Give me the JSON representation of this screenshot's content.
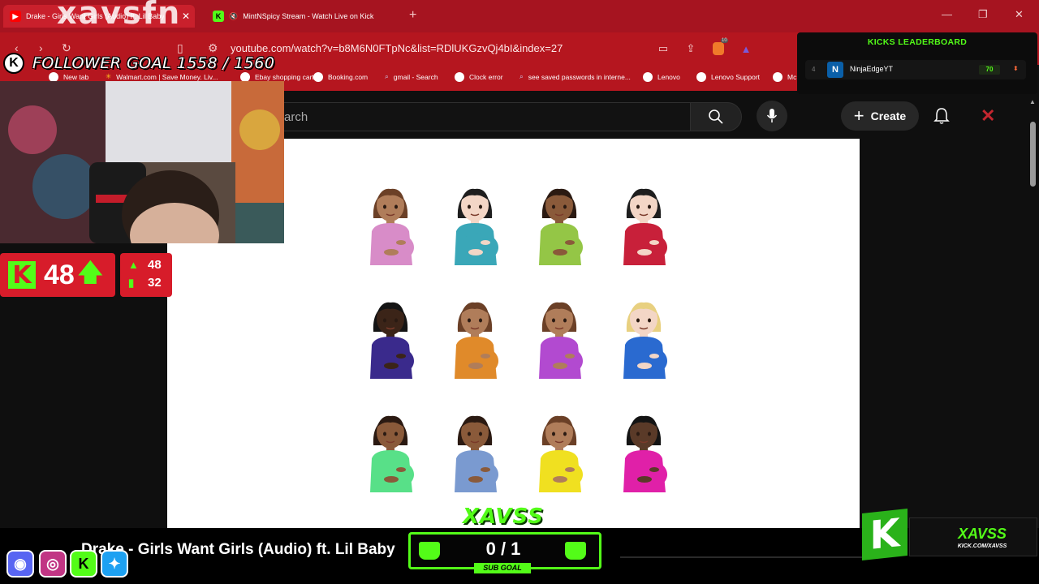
{
  "browser": {
    "tabs": [
      {
        "label": "Drake - Girls Want Girls (Audio) ft. Lil Baby",
        "active": true
      },
      {
        "label": "MintNSpicy Stream - Watch Live on Kick",
        "active": false
      }
    ],
    "url": "youtube.com/watch?v=b8M6N0FTpNc&list=RDlUKGzvQj4bI&index=27",
    "bookmarks": [
      "New tab",
      "Walmart.com | Save Money. Liv...",
      "Ebay shopping cart",
      "Booking.com",
      "gmail - Search",
      "Clock error",
      "see saved passwords in interne...",
      "Lenovo",
      "Lenovo Support",
      "Mc"
    ],
    "extension_badge": "10"
  },
  "youtube": {
    "search_placeholder": "arch",
    "create_label": "Create"
  },
  "overlay": {
    "channel_logo": "xavsfn",
    "follower_goal": "FOLLOWER GOAL 1558 / 1560",
    "kick_letter": "K",
    "follower_count": "48",
    "stat_up": "48",
    "stat_bars": "32",
    "leaderboard_title": "KICKS LEADERBOARD",
    "leaderboard": [
      {
        "rank": "4",
        "name": "NinjaEdgeYT",
        "value": "70"
      }
    ],
    "now_playing": "Drake - Girls Want Girls (Audio) ft. Lil Baby",
    "sub_goal_value": "0 / 1",
    "sub_goal_label": "SUB GOAL",
    "streamer_name": "XAVSS",
    "streamer_url": "KICK.COM/XAVSS",
    "sub_goal_banner": "XAVSS"
  },
  "emojis": [
    {
      "skin": "#b07d5a",
      "hair": "#6b4027",
      "shirt": "#d88cc8"
    },
    {
      "skin": "#f3d6c6",
      "hair": "#1e1e1e",
      "shirt": "#3aa7b8"
    },
    {
      "skin": "#8a5a3a",
      "hair": "#2b1a12",
      "shirt": "#94c646"
    },
    {
      "skin": "#f3d6c6",
      "hair": "#1e1e1e",
      "shirt": "#c8203a"
    },
    {
      "skin": "#3b2418",
      "hair": "#141414",
      "shirt": "#3a2a8c"
    },
    {
      "skin": "#b07d5a",
      "hair": "#6b4027",
      "shirt": "#e08a2a"
    },
    {
      "skin": "#b07d5a",
      "hair": "#6b4027",
      "shirt": "#b24ad0"
    },
    {
      "skin": "#f3d6c6",
      "hair": "#e8d080",
      "shirt": "#2a6ad0"
    },
    {
      "skin": "#8a5a3a",
      "hair": "#2b1a12",
      "shirt": "#58e088"
    },
    {
      "skin": "#8a5a3a",
      "hair": "#2b1a12",
      "shirt": "#7a9ad0"
    },
    {
      "skin": "#b07d5a",
      "hair": "#6b4027",
      "shirt": "#f0e020"
    },
    {
      "skin": "#5a3a28",
      "hair": "#141414",
      "shirt": "#e020a8"
    }
  ],
  "colors": {
    "kick_green": "#53fc18",
    "overlay_red": "#d71c2a",
    "browser_red": "#b5161f"
  }
}
